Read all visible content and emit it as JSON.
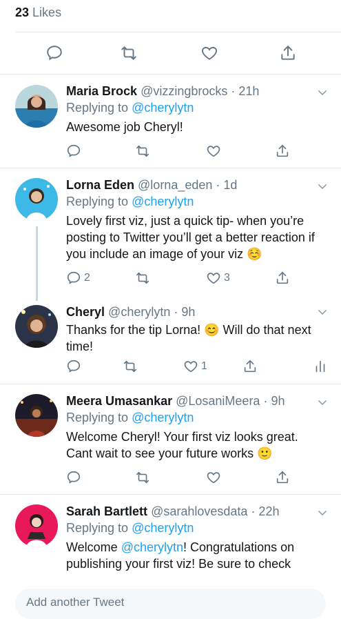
{
  "likes": {
    "count": "23",
    "label": "Likes"
  },
  "composer": {
    "placeholder": "Add another Tweet"
  },
  "tweets": [
    {
      "name": "Maria Brock",
      "handle": "@vizzingbrocks",
      "time": "· 21h",
      "replying_label": "Replying to",
      "replying_to": "@cherylytn",
      "text": "Awesome job Cheryl!",
      "reply_count": "",
      "like_count": ""
    },
    {
      "name": "Lorna Eden",
      "handle": "@lorna_eden",
      "time": "· 1d",
      "replying_label": "Replying to",
      "replying_to": "@cherylytn",
      "text": "Lovely first viz, just a quick tip- when you’re posting to Twitter you’ll get a better reaction if you include an image of your viz ☺️",
      "reply_count": "2",
      "like_count": "3"
    },
    {
      "name": "Cheryl",
      "handle": "@cherylytn",
      "time": "· 9h",
      "text": "Thanks for the tip Lorna! 😊 Will do that next time!",
      "reply_count": "",
      "like_count": "1"
    },
    {
      "name": "Meera Umasankar",
      "handle": "@LosaniMeera",
      "time": "· 9h",
      "replying_label": "Replying to",
      "replying_to": "@cherylytn",
      "text": "Welcome Cheryl! Your first viz looks great. Cant wait to see your future works 🙂",
      "reply_count": "",
      "like_count": ""
    },
    {
      "name": "Sarah Bartlett",
      "handle": "@sarahlovesdata",
      "time": "· 22h",
      "replying_label": "Replying to",
      "replying_to": "@cherylytn",
      "text_prefix": "Welcome ",
      "text_mention": "@cherylytn",
      "text_suffix": "! Congratulations on publishing your first viz! Be sure to check"
    }
  ],
  "colors": {
    "accent": "#1da1f2",
    "muted": "#657786",
    "text": "#14171a",
    "divider": "#e6ecf0"
  },
  "icons": [
    "reply-icon",
    "retweet-icon",
    "like-icon",
    "share-icon",
    "analytics-icon",
    "chevron-down-icon"
  ]
}
